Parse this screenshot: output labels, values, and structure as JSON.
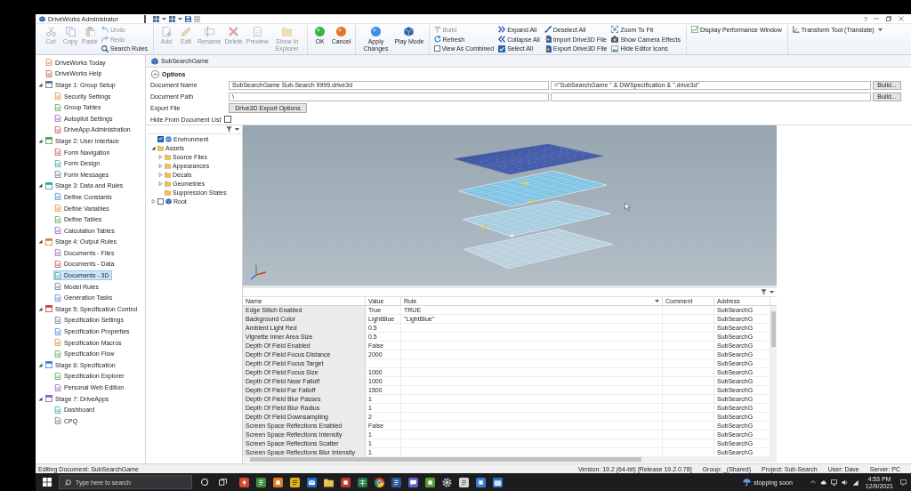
{
  "window": {
    "title": "DriveWorks Administrator",
    "help": "?"
  },
  "ribbon": {
    "groups": [
      {
        "items": [
          {
            "label": "Cut",
            "kind": "large",
            "disabled": true
          },
          {
            "label": "Copy",
            "kind": "large",
            "disabled": true
          },
          {
            "label": "Paste",
            "kind": "large",
            "disabled": true
          },
          {
            "label": "Undo",
            "kind": "small",
            "disabled": true
          },
          {
            "label": "Redo",
            "kind": "small",
            "disabled": true
          },
          {
            "label": "Search Rules",
            "kind": "small",
            "disabled": false
          }
        ]
      },
      {
        "items": [
          {
            "label": "Add",
            "kind": "large",
            "disabled": true
          },
          {
            "label": "Edit",
            "kind": "large",
            "disabled": true
          },
          {
            "label": "Rename",
            "kind": "large",
            "disabled": true
          },
          {
            "label": "Delete",
            "kind": "large",
            "disabled": true
          },
          {
            "label": "Preview",
            "kind": "large",
            "disabled": true
          },
          {
            "label": "Show In Explorer",
            "kind": "large",
            "disabled": true
          }
        ]
      },
      {
        "items": [
          {
            "label": "OK",
            "kind": "large",
            "disabled": false
          },
          {
            "label": "Cancel",
            "kind": "large",
            "disabled": false
          }
        ]
      },
      {
        "items": [
          {
            "label": "Apply Changes",
            "kind": "large",
            "disabled": false
          },
          {
            "label": "Play Mode",
            "kind": "large",
            "disabled": false
          }
        ]
      },
      {
        "items": [
          {
            "label": "Build",
            "kind": "small",
            "disabled": true
          },
          {
            "label": "Refresh",
            "kind": "small",
            "disabled": false
          },
          {
            "label": "View As Combined",
            "kind": "checkbox",
            "disabled": false,
            "checked": false
          },
          {
            "label": "Expand All",
            "kind": "small",
            "disabled": false
          },
          {
            "label": "Collapse All",
            "kind": "small",
            "disabled": false
          },
          {
            "label": "Select All",
            "kind": "small",
            "disabled": false
          },
          {
            "label": "Deselect All",
            "kind": "small",
            "disabled": false
          },
          {
            "label": "Import Drive3D File",
            "kind": "small",
            "disabled": false
          },
          {
            "label": "Export Drive3D File",
            "kind": "small",
            "disabled": false
          },
          {
            "label": "Zoom To Fit",
            "kind": "small",
            "disabled": false
          },
          {
            "label": "Show Camera Effects",
            "kind": "small",
            "disabled": false
          },
          {
            "label": "Hide Editor Icons",
            "kind": "small",
            "disabled": false
          }
        ]
      },
      {
        "items": [
          {
            "label": "Display Performance Window",
            "kind": "small",
            "disabled": false
          }
        ]
      },
      {
        "items": [
          {
            "label": "Transform Tool (Translate)",
            "kind": "dropdown",
            "disabled": false
          }
        ]
      }
    ]
  },
  "navigation": {
    "items": [
      {
        "label": "DriveWorks Today",
        "selected": false
      },
      {
        "label": "DriveWorks Help",
        "selected": false
      },
      {
        "label": "Stage 1: Group Setup",
        "selected": false,
        "expanded": true,
        "children": [
          {
            "label": "Security Settings",
            "selected": false
          },
          {
            "label": "Group Tables",
            "selected": false
          },
          {
            "label": "Autopilot Settings",
            "selected": false
          },
          {
            "label": "DriveApp Administration",
            "selected": false
          }
        ]
      },
      {
        "label": "Stage 2: User Interface",
        "selected": false,
        "expanded": true,
        "children": [
          {
            "label": "Form Navigation",
            "selected": false
          },
          {
            "label": "Form Design",
            "selected": false
          },
          {
            "label": "Form Messages",
            "selected": false
          }
        ]
      },
      {
        "label": "Stage 3: Data and Rules",
        "selected": false,
        "expanded": true,
        "children": [
          {
            "label": "Define Constants",
            "selected": false
          },
          {
            "label": "Define Variables",
            "selected": false
          },
          {
            "label": "Define Tables",
            "selected": false
          },
          {
            "label": "Calculation Tables",
            "selected": false
          }
        ]
      },
      {
        "label": "Stage 4: Output Rules",
        "selected": false,
        "expanded": true,
        "children": [
          {
            "label": "Documents - Files",
            "selected": false
          },
          {
            "label": "Documents - Data",
            "selected": false
          },
          {
            "label": "Documents - 3D",
            "selected": true
          },
          {
            "label": "Model Rules",
            "selected": false
          },
          {
            "label": "Generation Tasks",
            "selected": false
          }
        ]
      },
      {
        "label": "Stage 5: Specification Control",
        "selected": false,
        "expanded": true,
        "children": [
          {
            "label": "Specification Settings",
            "selected": false
          },
          {
            "label": "Specification Properties",
            "selected": false
          },
          {
            "label": "Specification Macros",
            "selected": false
          },
          {
            "label": "Specification Flow",
            "selected": false
          }
        ]
      },
      {
        "label": "Stage 6: Specification",
        "selected": false,
        "expanded": true,
        "children": [
          {
            "label": "Specification Explorer",
            "selected": false
          },
          {
            "label": "Personal Web Edition",
            "selected": false
          }
        ]
      },
      {
        "label": "Stage 7: DriveApps",
        "selected": false,
        "expanded": true,
        "children": [
          {
            "label": "Dashboard",
            "selected": false
          },
          {
            "label": "CPQ",
            "selected": false
          }
        ]
      }
    ]
  },
  "document": {
    "title": "SubSearchGame"
  },
  "options": {
    "title": "Options",
    "expanded": true,
    "rows": [
      {
        "label": "Document Name",
        "kind": "text",
        "value": "SubSearchGame Sub-Search 9999.drive3d",
        "rule": "=\"SubSearchGame \" & DWSpecification & \".drive3d\"",
        "button": "Build..."
      },
      {
        "label": "Document Path",
        "kind": "text",
        "value": "\\",
        "button": "Build..."
      },
      {
        "label": "Export File",
        "kind": "button",
        "button": "Drive3D Export Options"
      },
      {
        "label": "Hide From Document List",
        "kind": "checkbox",
        "checked": false
      }
    ]
  },
  "scene_tree": {
    "items": [
      {
        "label": "Environment",
        "kind": "environment",
        "checked": true
      },
      {
        "label": "Assets",
        "kind": "folder",
        "expanded": true,
        "children": [
          {
            "label": "Source Files",
            "kind": "folder",
            "expanded": false
          },
          {
            "label": "Appearances",
            "kind": "folder",
            "expanded": false
          },
          {
            "label": "Decals",
            "kind": "folder",
            "expanded": false
          },
          {
            "label": "Geometries",
            "kind": "folder",
            "expanded": false
          },
          {
            "label": "Suppression States",
            "kind": "folder"
          }
        ]
      },
      {
        "label": "Root",
        "kind": "model",
        "expanded": false,
        "checked": false
      }
    ]
  },
  "property_grid": {
    "columns": [
      {
        "label": "Name",
        "filter": false
      },
      {
        "label": "Value",
        "filter": false
      },
      {
        "label": "Rule",
        "filter": true
      },
      {
        "label": "Comment",
        "filter": false
      },
      {
        "label": "Address",
        "filter": false
      }
    ],
    "rows": [
      {
        "name": "Edge Stitch Enabled",
        "value": "True",
        "rule": "TRUE",
        "address": "SubSearchG"
      },
      {
        "name": "Background Color",
        "value": "LightBlue",
        "rule": "\"LightBlue\"",
        "address": "SubSearchG"
      },
      {
        "name": "Ambient Light Red",
        "value": "0.5",
        "address": "SubSearchG"
      },
      {
        "name": "Vignette Inner Area Size",
        "value": "0.5",
        "address": "SubSearchG"
      },
      {
        "name": "Depth Of Field Enabled",
        "value": "False",
        "address": "SubSearchG"
      },
      {
        "name": "Depth Of Field Focus Distance",
        "value": "2000",
        "address": "SubSearchG"
      },
      {
        "name": "Depth Of Field Focus Target",
        "address": "SubSearchG"
      },
      {
        "name": "Depth Of Field Focus Size",
        "value": "1000",
        "address": "SubSearchG"
      },
      {
        "name": "Depth Of Field Near Falloff",
        "value": "1000",
        "address": "SubSearchG"
      },
      {
        "name": "Depth Of Field Far Falloff",
        "value": "1500",
        "address": "SubSearchG"
      },
      {
        "name": "Depth Of Field Blur Passes",
        "value": "1",
        "address": "SubSearchG"
      },
      {
        "name": "Depth Of Field Blur Radius",
        "value": "1",
        "address": "SubSearchG"
      },
      {
        "name": "Depth Of Field Downsampling",
        "value": "2",
        "address": "SubSearchG"
      },
      {
        "name": "Screen Space Reflections Enabled",
        "value": "False",
        "address": "SubSearchG"
      },
      {
        "name": "Screen Space Reflections Intensity",
        "value": "1",
        "address": "SubSearchG"
      },
      {
        "name": "Screen Space Reflections Scatter",
        "value": "1",
        "address": "SubSearchG"
      },
      {
        "name": "Screen Space Reflections Blur Intensity",
        "value": "1",
        "address": "SubSearchG"
      }
    ]
  },
  "status_bar": {
    "message": "Editing Document: SubSearchGame",
    "fields": [
      "Version: 19.2 (64-bit) [Release 19.2.0.78]",
      "Group: _(Shared)",
      "Project: Sub-Search",
      "User: Dave",
      "Server: PC"
    ]
  },
  "taskbar": {
    "search": {
      "placeholder": "Type here to search"
    },
    "weather": "stopping soon",
    "time": "4:53 PM",
    "date": "12/9/2021"
  }
}
